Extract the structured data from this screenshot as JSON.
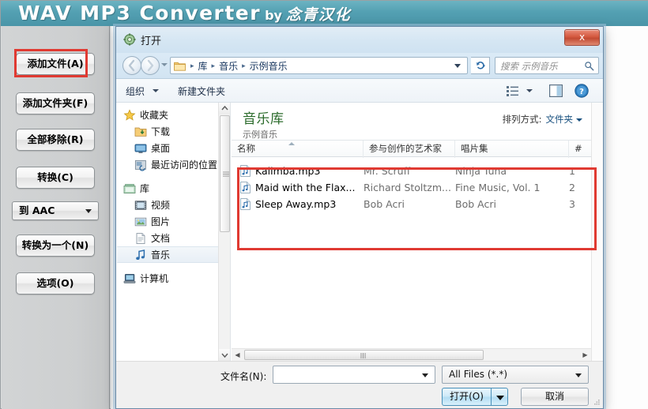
{
  "app": {
    "title_main": "WAV MP3 Converter",
    "title_by": "by",
    "title_brand": "念青汉化",
    "header_color": "#53a0b2",
    "sidebar_buttons": [
      {
        "label": "添加文件(A)",
        "name": "add-file-button",
        "highlighted": true
      },
      {
        "label": "添加文件夹(F)",
        "name": "add-folder-button",
        "highlighted": false
      },
      {
        "label": "全部移除(R)",
        "name": "remove-all-button",
        "highlighted": false
      },
      {
        "label": "转换(C)",
        "name": "convert-button",
        "highlighted": false
      }
    ],
    "format_combo": {
      "label": "到 AAC"
    },
    "sidebar_buttons2": [
      {
        "label": "转换为一个(N)",
        "name": "convert-to-one-button"
      },
      {
        "label": "选项(O)",
        "name": "options-button"
      }
    ]
  },
  "dialog": {
    "title": "打开",
    "close_label": "x",
    "address": {
      "crumbs": [
        "库",
        "音乐",
        "示例音乐"
      ],
      "separator": "▸"
    },
    "search_placeholder": "搜索 示例音乐",
    "refresh_glyph": "↻",
    "toolbar": {
      "organize": "组织",
      "new_folder": "新建文件夹"
    },
    "nav_pane": [
      {
        "label": "收藏夹",
        "level": 0,
        "icon": "star-icon",
        "selected": false
      },
      {
        "label": "下载",
        "level": 1,
        "icon": "downloads-icon",
        "selected": false
      },
      {
        "label": "桌面",
        "level": 1,
        "icon": "desktop-icon",
        "selected": false
      },
      {
        "label": "最近访问的位置",
        "level": 1,
        "icon": "recent-places-icon",
        "selected": false
      },
      {
        "label": "库",
        "level": 0,
        "icon": "library-icon",
        "selected": false
      },
      {
        "label": "视频",
        "level": 1,
        "icon": "video-icon",
        "selected": false
      },
      {
        "label": "图片",
        "level": 1,
        "icon": "pictures-icon",
        "selected": false
      },
      {
        "label": "文档",
        "level": 1,
        "icon": "documents-icon",
        "selected": false
      },
      {
        "label": "音乐",
        "level": 1,
        "icon": "music-icon",
        "selected": true
      },
      {
        "label": "计算机",
        "level": 0,
        "icon": "computer-icon",
        "selected": false
      }
    ],
    "library": {
      "title": "音乐库",
      "subtitle": "示例音乐",
      "arrange_label": "排列方式:",
      "arrange_value": "文件夹"
    },
    "columns": [
      {
        "label": "名称"
      },
      {
        "label": "参与创作的艺术家"
      },
      {
        "label": "唱片集"
      },
      {
        "label": "#"
      }
    ],
    "files": [
      {
        "name": "Kalimba.mp3",
        "artist": "Mr. Scruff",
        "album": "Ninja Tuna",
        "num": "1"
      },
      {
        "name": "Maid with the Flax...",
        "artist": "Richard Stoltzm...",
        "album": "Fine Music, Vol. 1",
        "num": "2"
      },
      {
        "name": "Sleep Away.mp3",
        "artist": "Bob Acri",
        "album": "Bob Acri",
        "num": "3"
      }
    ],
    "bottom": {
      "filename_label": "文件名(N):",
      "filename_value": "",
      "filter_value": "All Files (*.*)",
      "open_label": "打开(O)",
      "cancel_label": "取消"
    }
  },
  "annotations": {
    "accent_color": "#e03a32",
    "box1_name": "highlight-add-file",
    "box2_name": "highlight-file-list"
  }
}
